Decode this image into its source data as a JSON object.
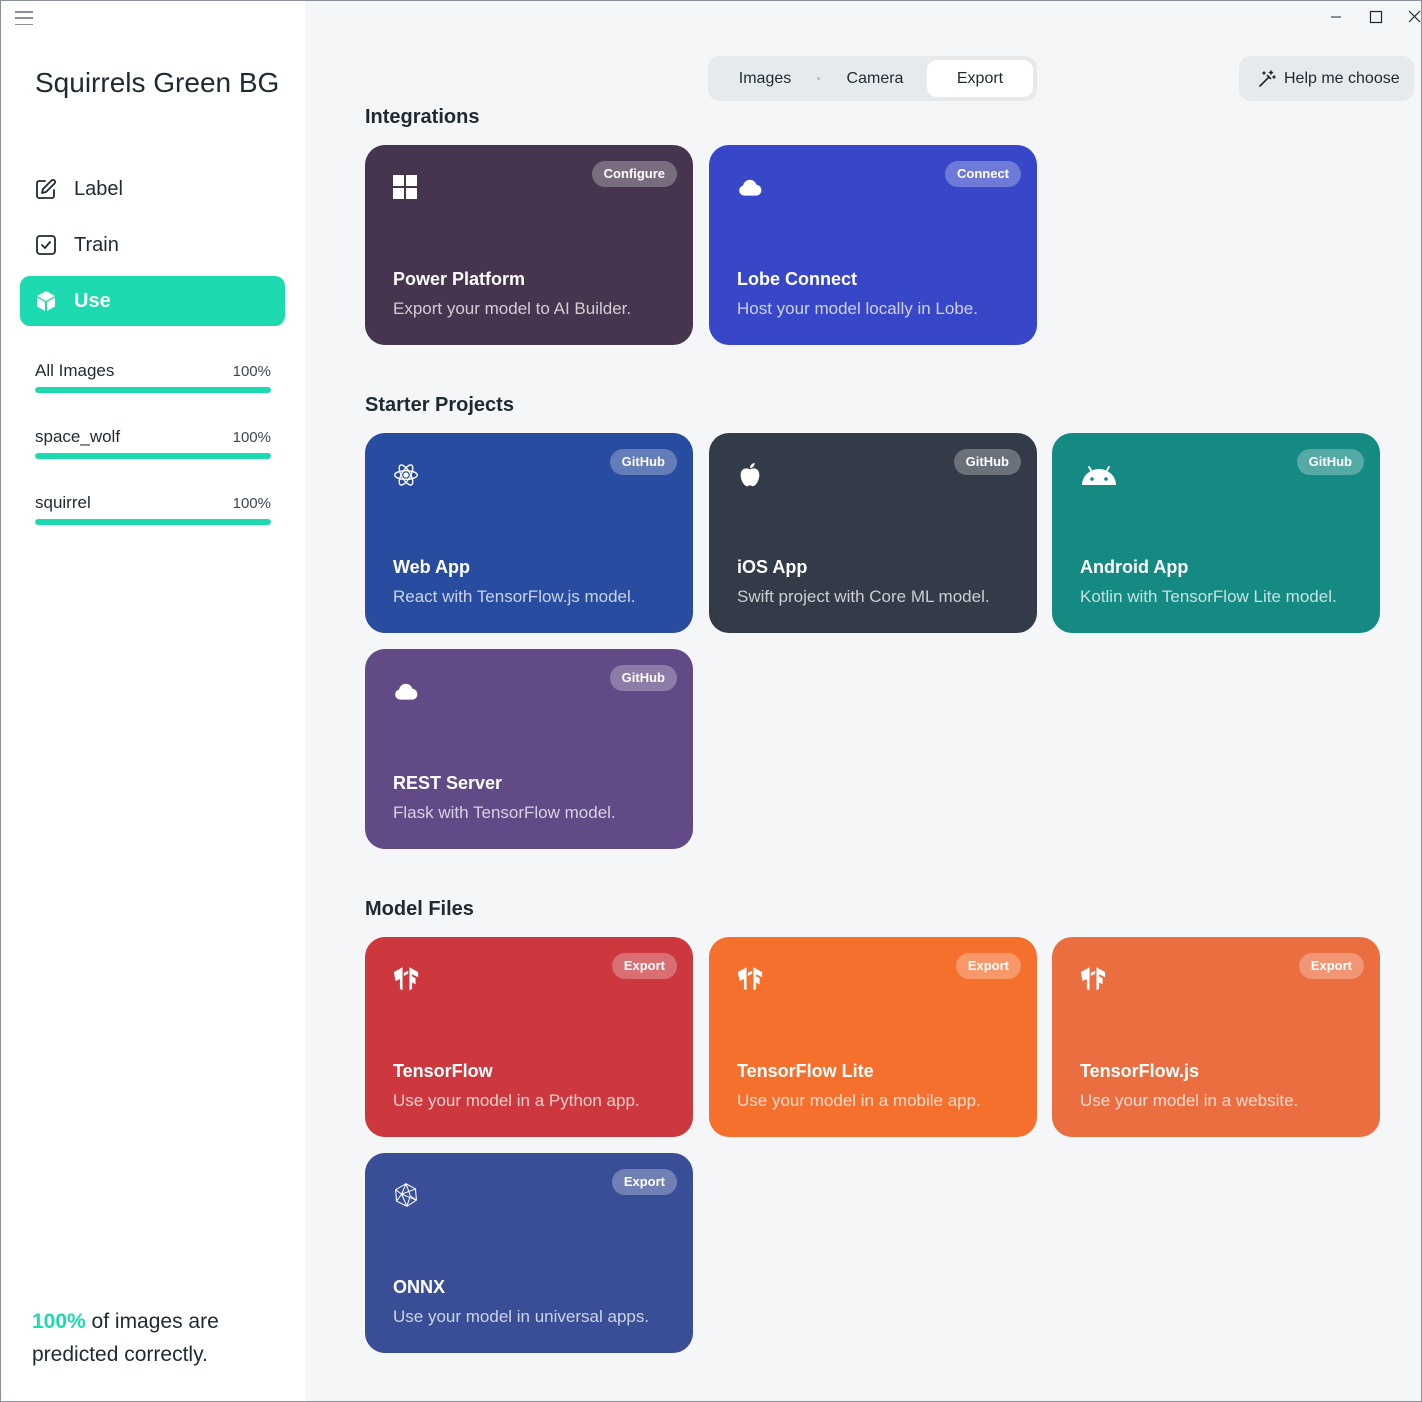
{
  "project": {
    "title": "Squirrels Green BG"
  },
  "nav": [
    {
      "label": "Label",
      "icon": "pencil-icon",
      "active": false
    },
    {
      "label": "Train",
      "icon": "checkbox-icon",
      "active": false
    },
    {
      "label": "Use",
      "icon": "cube-icon",
      "active": true
    }
  ],
  "labels": [
    {
      "name": "All Images",
      "percent": "100%",
      "progress": 1.0
    },
    {
      "name": "space_wolf",
      "percent": "100%",
      "progress": 1.0
    },
    {
      "name": "squirrel",
      "percent": "100%",
      "progress": 1.0
    }
  ],
  "summary": {
    "percent": "100%",
    "text": " of images are predicted correctly."
  },
  "tabs": [
    {
      "label": "Images",
      "active": false
    },
    {
      "label": "Camera",
      "active": false
    },
    {
      "label": "Export",
      "active": true
    }
  ],
  "help_button": {
    "label": "Help me choose",
    "icon": "magic-wand-icon"
  },
  "sections": {
    "integrations": "Integrations",
    "starter_projects": "Starter Projects",
    "model_files": "Model Files"
  },
  "cards": {
    "power_platform": {
      "title": "Power Platform",
      "desc": "Export your model to AI Builder.",
      "badge": "Configure",
      "icon": "windows-icon",
      "color": "#47344e"
    },
    "lobe_connect": {
      "title": "Lobe Connect",
      "desc": "Host your model locally in Lobe.",
      "badge": "Connect",
      "icon": "cloud-icon",
      "color": "#3747c8"
    },
    "web_app": {
      "title": "Web App",
      "desc": "React with TensorFlow.js model.",
      "badge": "GitHub",
      "icon": "react-icon",
      "color": "#284c9f"
    },
    "ios_app": {
      "title": "iOS App",
      "desc": "Swift project with Core ML model.",
      "badge": "GitHub",
      "icon": "apple-icon",
      "color": "#333b48"
    },
    "android_app": {
      "title": "Android App",
      "desc": "Kotlin with TensorFlow Lite model.",
      "badge": "GitHub",
      "icon": "android-icon",
      "color": "#158a83"
    },
    "rest_server": {
      "title": "REST Server",
      "desc": "Flask with TensorFlow model.",
      "badge": "GitHub",
      "icon": "cloud-icon",
      "color": "#624a86"
    },
    "tensorflow": {
      "title": "TensorFlow",
      "desc": "Use your model in a Python app.",
      "badge": "Export",
      "icon": "tensorflow-icon",
      "color": "#cc383d"
    },
    "tensorflow_lite": {
      "title": "TensorFlow Lite",
      "desc": "Use your model in a mobile app.",
      "badge": "Export",
      "icon": "tensorflow-icon",
      "color": "#f5702d"
    },
    "tensorflow_js": {
      "title": "TensorFlow.js",
      "desc": "Use your model in a website.",
      "badge": "Export",
      "icon": "tensorflow-icon",
      "color": "#eb6e40"
    },
    "onnx": {
      "title": "ONNX",
      "desc": "Use your model in universal apps.",
      "badge": "Export",
      "icon": "onnx-icon",
      "color": "#394e97"
    }
  },
  "colors": {
    "accent": "#1dd9b0",
    "background": "#f4f6f7",
    "sidebar": "#ffffff"
  }
}
